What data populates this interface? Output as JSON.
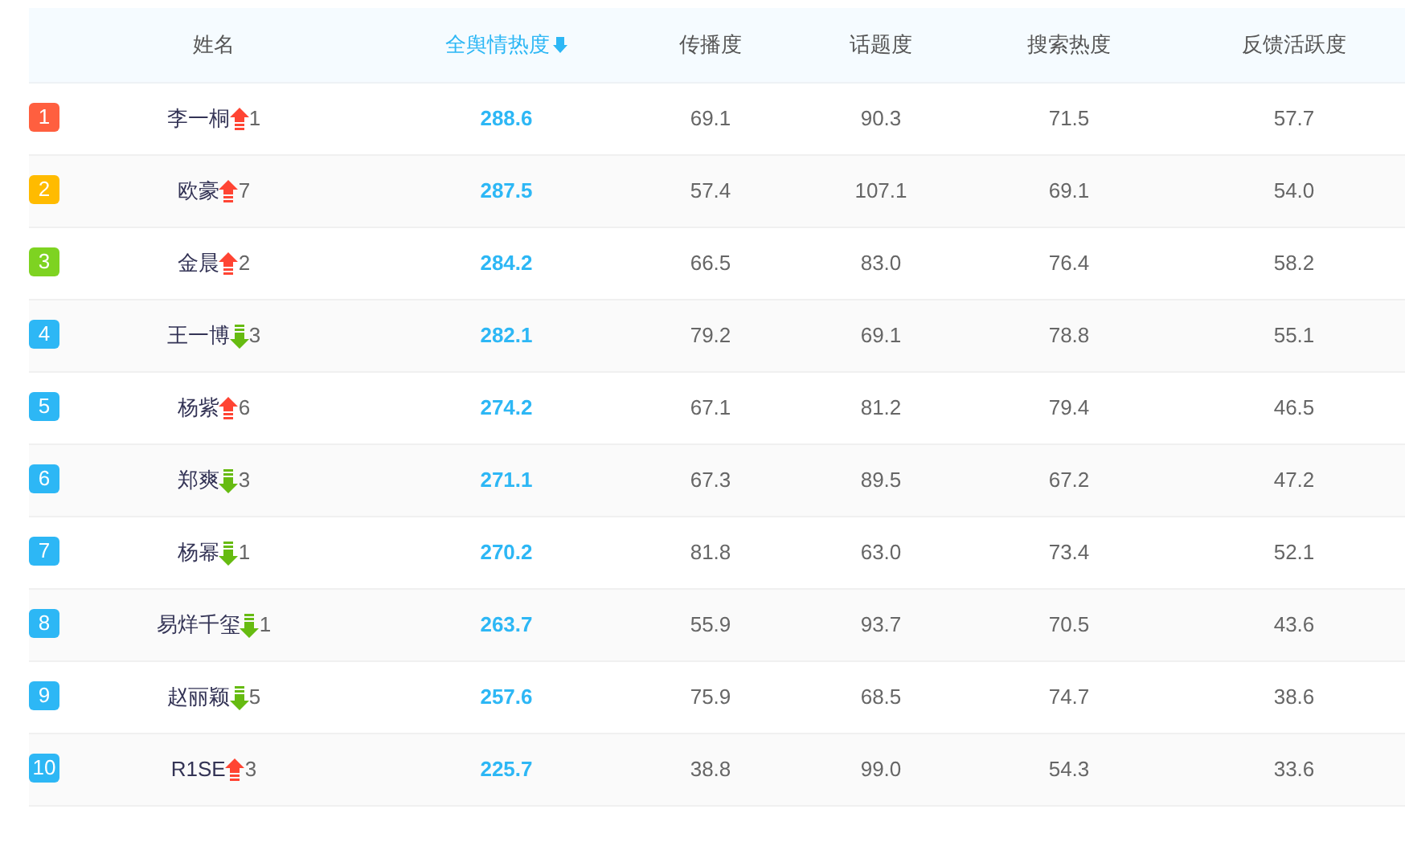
{
  "table": {
    "columns": [
      {
        "label": "姓名",
        "sorted": false
      },
      {
        "label": "全舆情热度",
        "sorted": true
      },
      {
        "label": "传播度",
        "sorted": false
      },
      {
        "label": "话题度",
        "sorted": false
      },
      {
        "label": "搜索热度",
        "sorted": false
      },
      {
        "label": "反馈活跃度",
        "sorted": false
      }
    ],
    "rows": [
      {
        "rank": "1",
        "color": "#ff5f3f",
        "rising": true,
        "change": "1",
        "cells": [
          "李一桐",
          "288.6",
          "69.1",
          "90.3",
          "71.5",
          "57.7"
        ]
      },
      {
        "rank": "2",
        "color": "#ffbb00",
        "rising": true,
        "change": "7",
        "cells": [
          "欧豪",
          "287.5",
          "57.4",
          "107.1",
          "69.1",
          "54.0"
        ]
      },
      {
        "rank": "3",
        "color": "#7ed321",
        "rising": true,
        "change": "2",
        "cells": [
          "金晨",
          "284.2",
          "66.5",
          "83.0",
          "76.4",
          "58.2"
        ]
      },
      {
        "rank": "4",
        "color": "#2db7f5",
        "rising": false,
        "change": "3",
        "cells": [
          "王一博",
          "282.1",
          "79.2",
          "69.1",
          "78.8",
          "55.1"
        ]
      },
      {
        "rank": "5",
        "color": "#2db7f5",
        "rising": true,
        "change": "6",
        "cells": [
          "杨紫",
          "274.2",
          "67.1",
          "81.2",
          "79.4",
          "46.5"
        ]
      },
      {
        "rank": "6",
        "color": "#2db7f5",
        "rising": false,
        "change": "3",
        "cells": [
          "郑爽",
          "271.1",
          "67.3",
          "89.5",
          "67.2",
          "47.2"
        ]
      },
      {
        "rank": "7",
        "color": "#2db7f5",
        "rising": false,
        "change": "1",
        "cells": [
          "杨幂",
          "270.2",
          "81.8",
          "63.0",
          "73.4",
          "52.1"
        ]
      },
      {
        "rank": "8",
        "color": "#2db7f5",
        "rising": false,
        "change": "1",
        "cells": [
          "易烊千玺",
          "263.7",
          "55.9",
          "93.7",
          "70.5",
          "43.6"
        ]
      },
      {
        "rank": "9",
        "color": "#2db7f5",
        "rising": false,
        "change": "5",
        "cells": [
          "赵丽颖",
          "257.6",
          "75.9",
          "68.5",
          "74.7",
          "38.6"
        ]
      },
      {
        "rank": "10",
        "color": "#2db7f5",
        "rising": true,
        "change": "3",
        "cells": [
          "R1SE",
          "225.7",
          "38.8",
          "99.0",
          "54.3",
          "33.6"
        ]
      }
    ]
  }
}
